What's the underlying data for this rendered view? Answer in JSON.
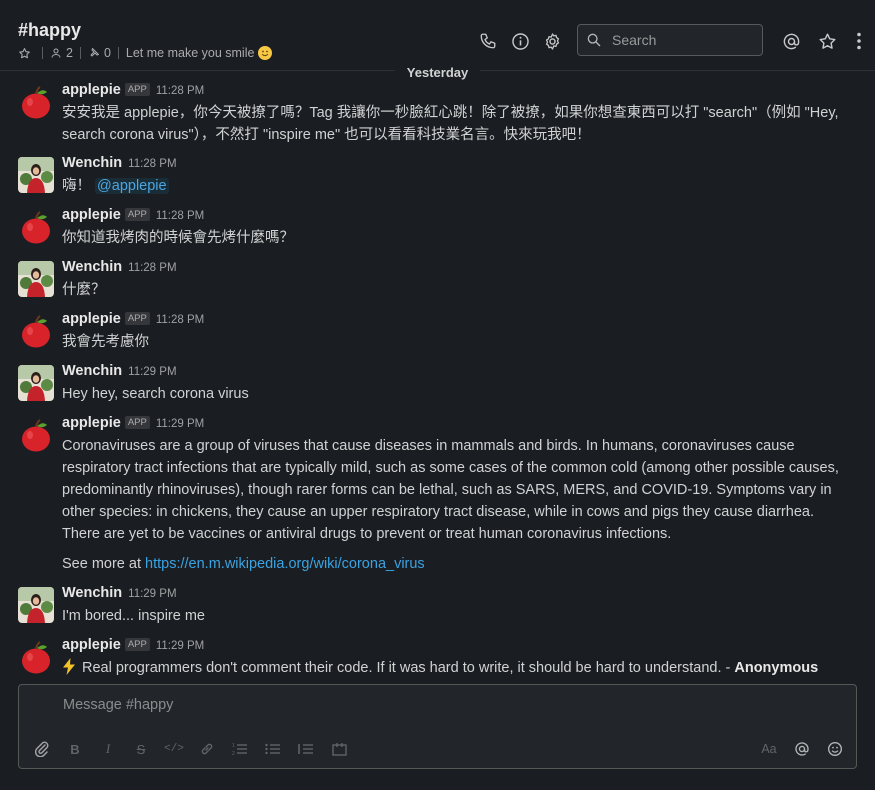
{
  "channel": {
    "name": "#happy",
    "members": "2",
    "pinned": "0",
    "topic": "Let me make you smile"
  },
  "header": {
    "icons": [
      "phone-icon",
      "info-icon",
      "gear-icon",
      "search-icon",
      "at-icon",
      "star-icon",
      "more-icon"
    ]
  },
  "search": {
    "placeholder": "Search"
  },
  "day_divider": "Yesterday",
  "messages": [
    {
      "author": "applepie",
      "badge": "APP",
      "time": "11:28 PM",
      "text": "安安我是 applepie，你今天被撩了嗎？Tag 我讓你一秒臉紅心跳！除了被撩，如果你想查東西可以打 \"search\"（例如 \"Hey, search corona virus\"），不然打 \"inspire me\" 也可以看看科技業名言。快來玩我吧！"
    },
    {
      "author": "Wenchin",
      "time": "11:28 PM",
      "text": "嗨！",
      "mention": "@applepie"
    },
    {
      "author": "applepie",
      "badge": "APP",
      "time": "11:28 PM",
      "text": "你知道我烤肉的時候會先烤什麼嗎？"
    },
    {
      "author": "Wenchin",
      "time": "11:28 PM",
      "text": "什麼？"
    },
    {
      "author": "applepie",
      "badge": "APP",
      "time": "11:28 PM",
      "text": "我會先考慮你"
    },
    {
      "author": "Wenchin",
      "time": "11:29 PM",
      "text": "Hey hey, search corona virus"
    },
    {
      "author": "applepie",
      "badge": "APP",
      "time": "11:29 PM",
      "text": "Coronaviruses are a group of viruses that cause diseases in mammals and birds. In humans, coronaviruses cause respiratory tract infections that are typically mild, such as some cases of the common cold (among other possible causes, predominantly rhinoviruses), though rarer forms can be lethal, such as SARS, MERS, and COVID-19. Symptoms vary in other species: in chickens, they cause an upper respiratory tract disease, while in cows and pigs they cause diarrhea. There are yet to be vaccines or antiviral drugs to prevent or treat human coronavirus infections.",
      "see_more": "See more at",
      "link": "https://en.m.wikipedia.org/wiki/corona_virus"
    },
    {
      "author": "Wenchin",
      "time": "11:29 PM",
      "text": "I'm bored... inspire me"
    },
    {
      "author": "applepie",
      "badge": "APP",
      "time": "11:29 PM",
      "text": "Real programmers don't comment their code. If it was hard to write, it should be hard to understand. - ",
      "attribution": "Anonymous"
    }
  ],
  "composer": {
    "placeholder": "Message #happy",
    "toolbar": [
      "attach-icon",
      "bold-icon",
      "italic-icon",
      "strikethrough-icon",
      "code-icon",
      "link-icon",
      "ordered-list-icon",
      "bulleted-list-icon",
      "blockquote-icon",
      "code-block-icon"
    ],
    "right_tools": {
      "format": "Aa"
    }
  }
}
